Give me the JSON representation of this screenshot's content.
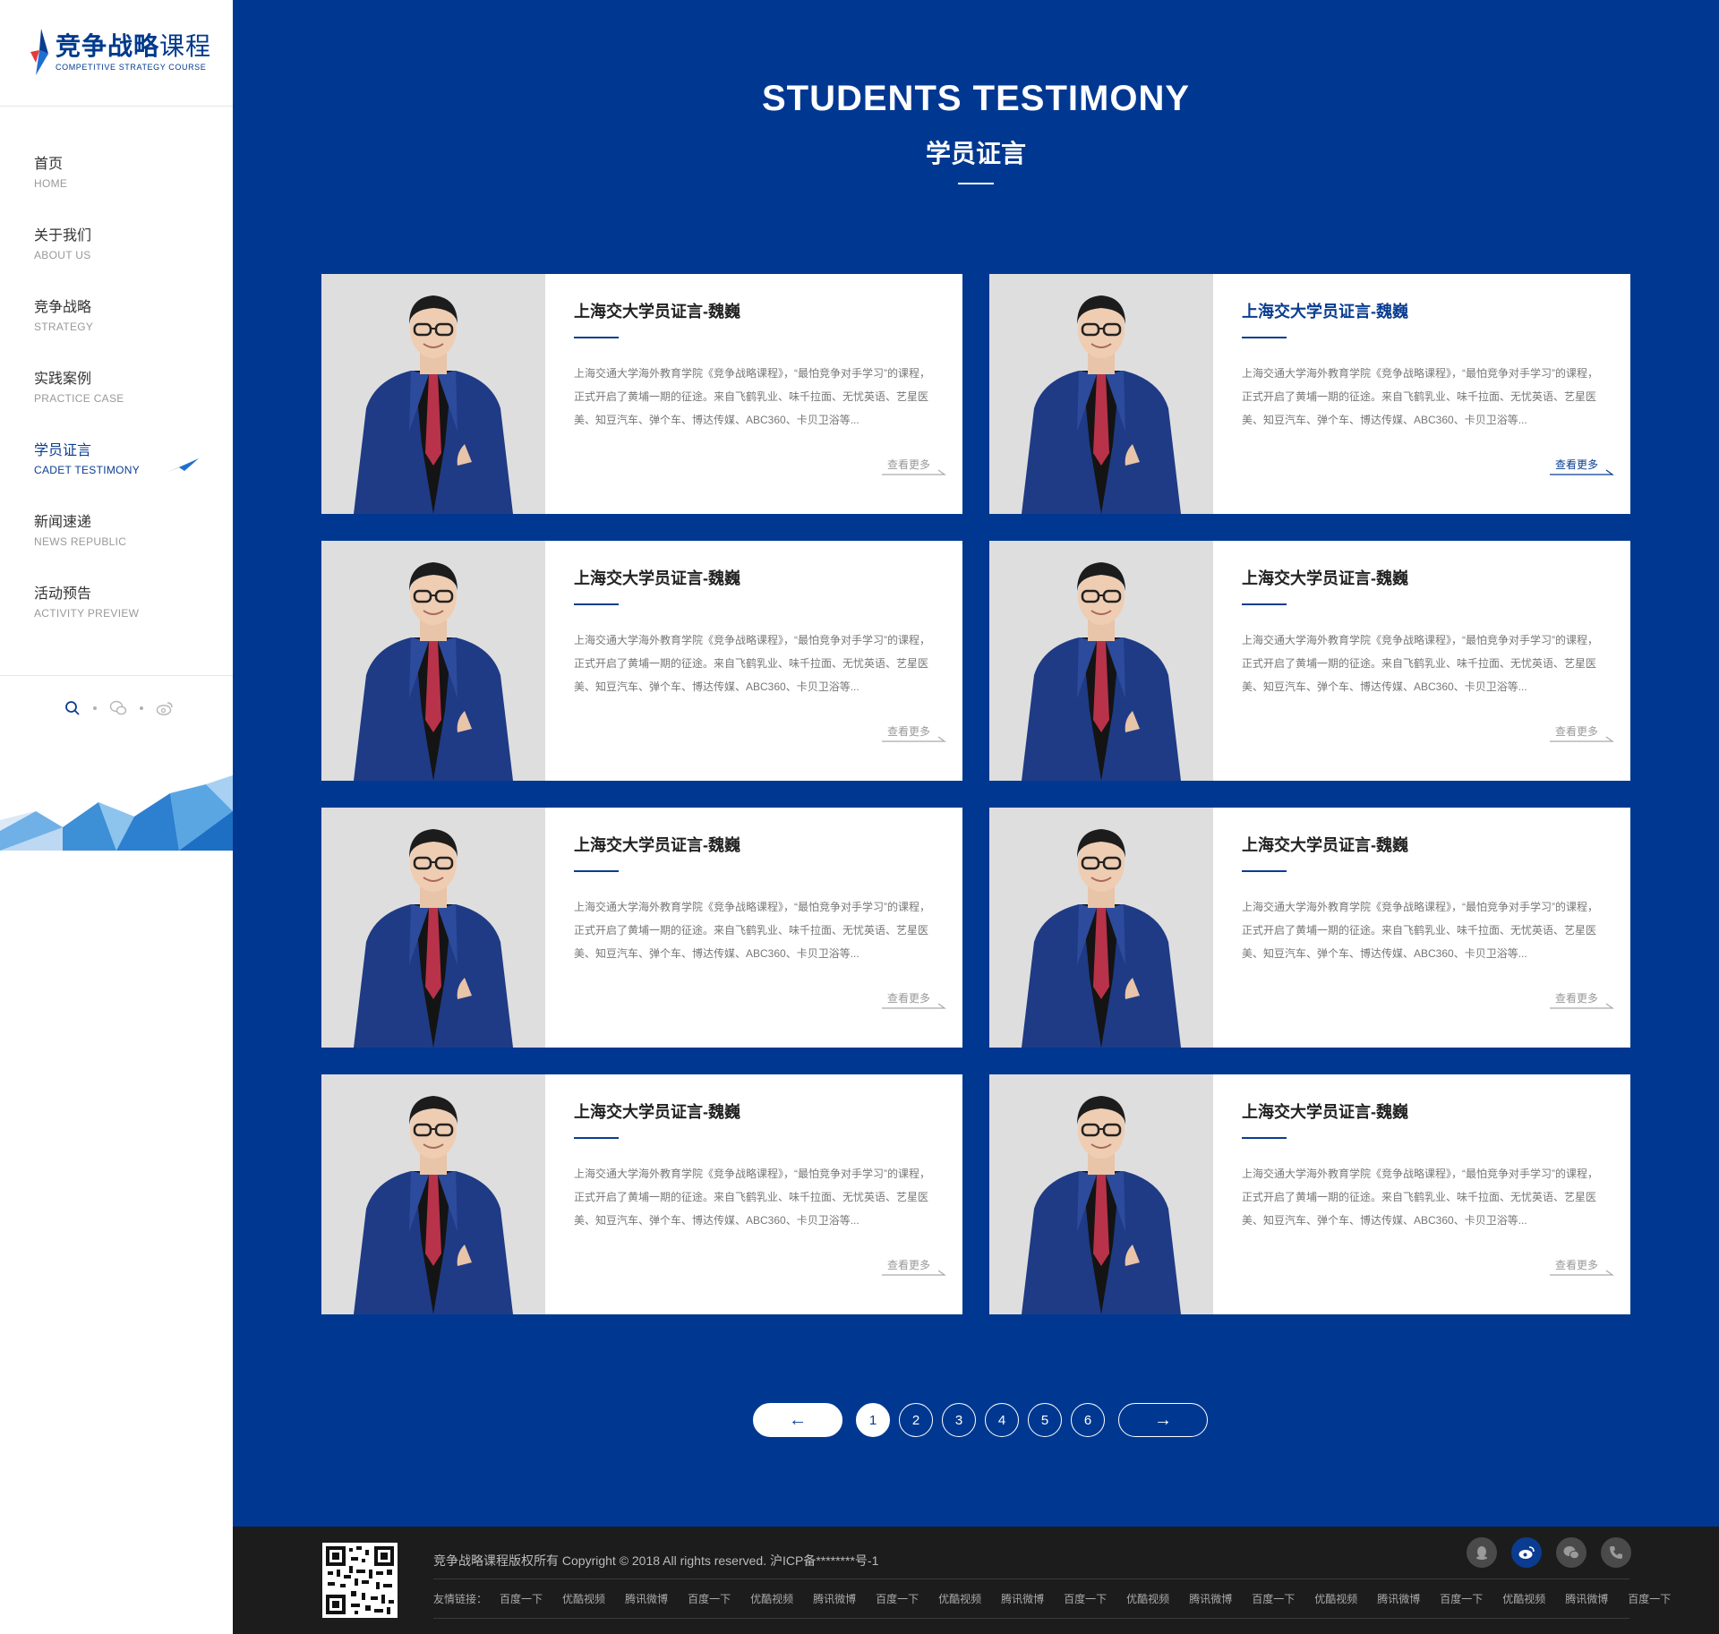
{
  "logo": {
    "cn_bold": "竞争战略",
    "cn_light": "课程",
    "en": "COMPETITIVE STRATEGY COURSE"
  },
  "nav": [
    {
      "cn": "首页",
      "en": "HOME"
    },
    {
      "cn": "关于我们",
      "en": "ABOUT US"
    },
    {
      "cn": "竞争战略",
      "en": "STRATEGY"
    },
    {
      "cn": "实践案例",
      "en": "PRACTICE CASE"
    },
    {
      "cn": "学员证言",
      "en": "CADET TESTIMONY",
      "active": true
    },
    {
      "cn": "新闻速递",
      "en": "NEWS REPUBLIC"
    },
    {
      "cn": "活动预告",
      "en": "ACTIVITY PREVIEW"
    }
  ],
  "side_icons": [
    "search-icon",
    "wechat-icon",
    "weibo-icon"
  ],
  "section": {
    "title_en": "STUDENTS TESTIMONY",
    "title_cn": "学员证言"
  },
  "cards": [
    {
      "title": "上海交大学员证言-魏巍",
      "desc": "上海交通大学海外教育学院《竞争战略课程》，“最怕竞争对手学习”的课程，正式开启了黄埔一期的征途。来自飞鹤乳业、味千拉面、无忧英语、艺星医美、知豆汽车、弹个车、博达传媒、ABC360、卡贝卫浴等...",
      "more": "查看更多"
    },
    {
      "title": "上海交大学员证言-魏巍",
      "desc": "上海交通大学海外教育学院《竞争战略课程》，“最怕竞争对手学习”的课程，正式开启了黄埔一期的征途。来自飞鹤乳业、味千拉面、无忧英语、艺星医美、知豆汽车、弹个车、博达传媒、ABC360、卡贝卫浴等...",
      "more": "查看更多",
      "highlight": true
    },
    {
      "title": "上海交大学员证言-魏巍",
      "desc": "上海交通大学海外教育学院《竞争战略课程》，“最怕竞争对手学习”的课程，正式开启了黄埔一期的征途。来自飞鹤乳业、味千拉面、无忧英语、艺星医美、知豆汽车、弹个车、博达传媒、ABC360、卡贝卫浴等...",
      "more": "查看更多"
    },
    {
      "title": "上海交大学员证言-魏巍",
      "desc": "上海交通大学海外教育学院《竞争战略课程》，“最怕竞争对手学习”的课程，正式开启了黄埔一期的征途。来自飞鹤乳业、味千拉面、无忧英语、艺星医美、知豆汽车、弹个车、博达传媒、ABC360、卡贝卫浴等...",
      "more": "查看更多"
    },
    {
      "title": "上海交大学员证言-魏巍",
      "desc": "上海交通大学海外教育学院《竞争战略课程》，“最怕竞争对手学习”的课程，正式开启了黄埔一期的征途。来自飞鹤乳业、味千拉面、无忧英语、艺星医美、知豆汽车、弹个车、博达传媒、ABC360、卡贝卫浴等...",
      "more": "查看更多"
    },
    {
      "title": "上海交大学员证言-魏巍",
      "desc": "上海交通大学海外教育学院《竞争战略课程》，“最怕竞争对手学习”的课程，正式开启了黄埔一期的征途。来自飞鹤乳业、味千拉面、无忧英语、艺星医美、知豆汽车、弹个车、博达传媒、ABC360、卡贝卫浴等...",
      "more": "查看更多"
    },
    {
      "title": "上海交大学员证言-魏巍",
      "desc": "上海交通大学海外教育学院《竞争战略课程》，“最怕竞争对手学习”的课程，正式开启了黄埔一期的征途。来自飞鹤乳业、味千拉面、无忧英语、艺星医美、知豆汽车、弹个车、博达传媒、ABC360、卡贝卫浴等...",
      "more": "查看更多"
    },
    {
      "title": "上海交大学员证言-魏巍",
      "desc": "上海交通大学海外教育学院《竞争战略课程》，“最怕竞争对手学习”的课程，正式开启了黄埔一期的征途。来自飞鹤乳业、味千拉面、无忧英语、艺星医美、知豆汽车、弹个车、博达传媒、ABC360、卡贝卫浴等...",
      "more": "查看更多"
    }
  ],
  "pagination": {
    "prev": "←",
    "next": "→",
    "pages": [
      "1",
      "2",
      "3",
      "4",
      "5",
      "6"
    ],
    "current": "1"
  },
  "footer": {
    "copyright": "竞争战略课程版权所有 Copyright © 2018 All rights reserved. 沪ICP备********号-1",
    "links_label": "友情链接：",
    "links": [
      "百度一下",
      "优酷视频",
      "腾讯微博",
      "百度一下",
      "优酷视频",
      "腾讯微博",
      "百度一下",
      "优酷视频",
      "腾讯微博",
      "百度一下",
      "优酷视频",
      "腾讯微博",
      "百度一下",
      "优酷视频",
      "腾讯微博",
      "百度一下",
      "优酷视频",
      "腾讯微博",
      "百度一下"
    ],
    "social": [
      "qq-icon",
      "weibo-icon",
      "wechat-icon",
      "phone-icon"
    ],
    "social_active": "weibo-icon"
  },
  "colors": {
    "brand_blue": "#003891",
    "accent_blue": "#0a3d91",
    "footer_bg": "#1c1c1c"
  }
}
